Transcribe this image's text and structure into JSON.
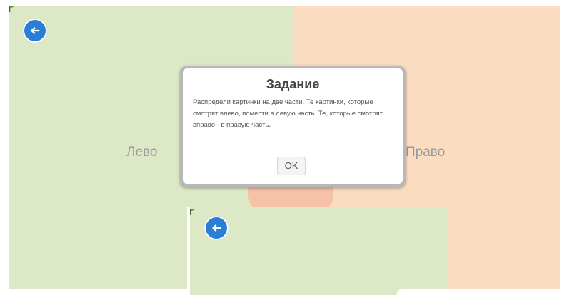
{
  "zones": {
    "left_label": "Лево",
    "right_label": "Право",
    "left_color": "#dde9c6",
    "right_color": "#fadcc1"
  },
  "dialog": {
    "title": "Задание",
    "text": "Распредели картинки на две части. Те картинки, которые смотрят влево, помести в левую часть. Те, которые смотрят вправо - в правую часть.",
    "ok_label": "OK"
  },
  "icons": {
    "back": "back-arrow-icon",
    "flag": "flag-icon"
  },
  "colors": {
    "accent": "#2a7ed6"
  }
}
